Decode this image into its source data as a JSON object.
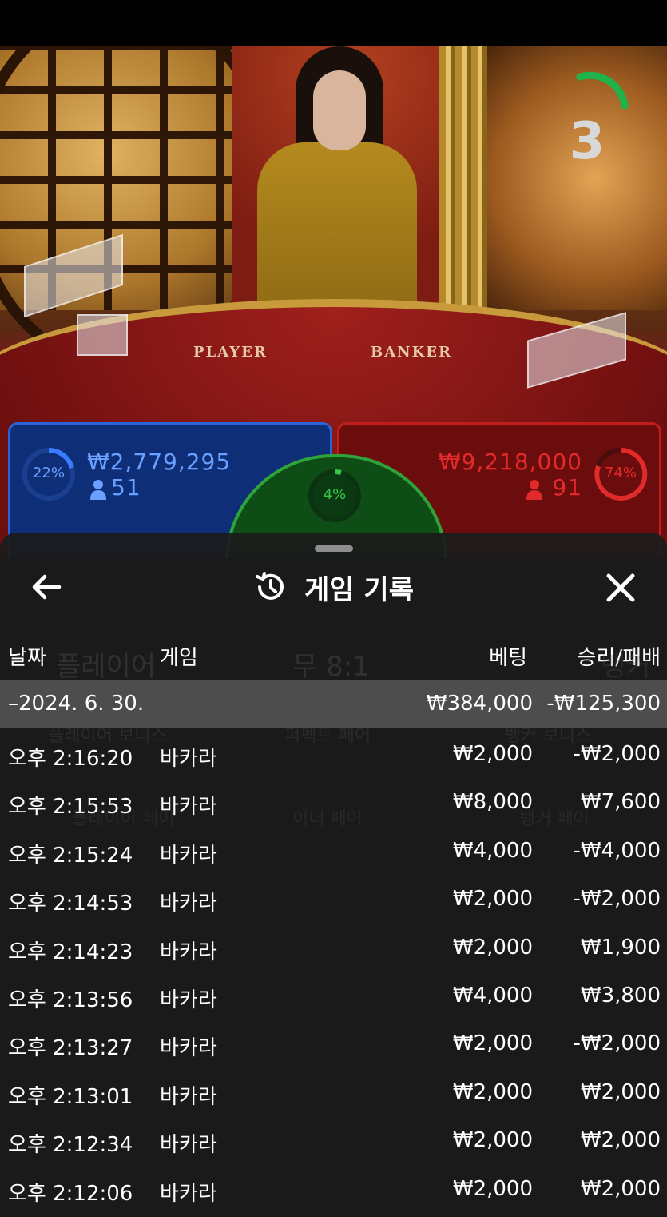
{
  "game_view": {
    "timer": "3",
    "table_labels": {
      "player": "PLAYER",
      "banker": "BANKER"
    },
    "player": {
      "percent": "22%",
      "amount": "₩2,779,295",
      "count": "51",
      "color": "#2a64d8"
    },
    "banker": {
      "percent": "74%",
      "amount": "₩9,218,000",
      "count": "91",
      "color": "#c21d1d"
    },
    "tie": {
      "percent": "4%",
      "color": "#2ea33a"
    },
    "obscured_labels": [
      "플레이어",
      "무 8:1",
      "뱅커",
      "플레이어 보너스",
      "퍼펙트 페어",
      "뱅커 보너스",
      "플레이어 페어",
      "이더 페어",
      "뱅커 페어"
    ]
  },
  "history": {
    "title": "게임 기록",
    "icons": {
      "back": "arrow-left-icon",
      "history": "history-icon",
      "close": "close-icon",
      "user": "user-icon"
    },
    "columns": {
      "date": "날짜",
      "game": "게임",
      "bet": "베팅",
      "result": "승리/패배"
    },
    "summary": {
      "date": "–2024. 6. 30.",
      "bet": "₩384,000",
      "result": "-₩125,300"
    },
    "rows": [
      {
        "time": "오후 2:16:20",
        "game": "바카라",
        "bet": "₩2,000",
        "result": "-₩2,000"
      },
      {
        "time": "오후 2:15:53",
        "game": "바카라",
        "bet": "₩8,000",
        "result": "₩7,600"
      },
      {
        "time": "오후 2:15:24",
        "game": "바카라",
        "bet": "₩4,000",
        "result": "-₩4,000"
      },
      {
        "time": "오후 2:14:53",
        "game": "바카라",
        "bet": "₩2,000",
        "result": "-₩2,000"
      },
      {
        "time": "오후 2:14:23",
        "game": "바카라",
        "bet": "₩2,000",
        "result": "₩1,900"
      },
      {
        "time": "오후 2:13:56",
        "game": "바카라",
        "bet": "₩4,000",
        "result": "₩3,800"
      },
      {
        "time": "오후 2:13:27",
        "game": "바카라",
        "bet": "₩2,000",
        "result": "-₩2,000"
      },
      {
        "time": "오후 2:13:01",
        "game": "바카라",
        "bet": "₩2,000",
        "result": "₩2,000"
      },
      {
        "time": "오후 2:12:34",
        "game": "바카라",
        "bet": "₩2,000",
        "result": "₩2,000"
      },
      {
        "time": "오후 2:12:06",
        "game": "바카라",
        "bet": "₩2,000",
        "result": "₩2,000"
      }
    ]
  }
}
